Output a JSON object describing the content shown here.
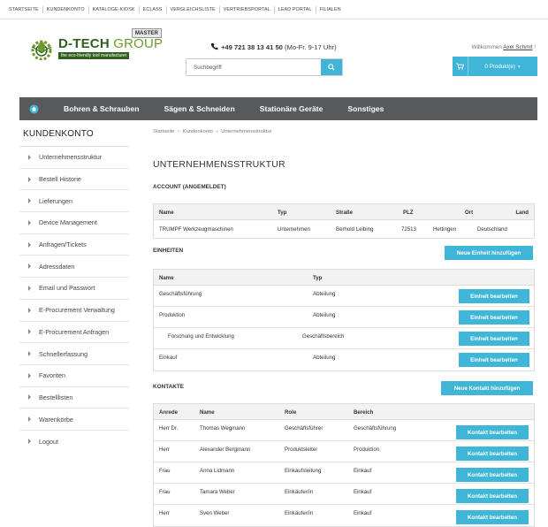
{
  "topnav": [
    "STARTSEITE",
    "KUNDENKONTO",
    "KATALOGE-KIOSK",
    "ECLASS",
    "VERGLEICHSLISTE",
    "VERTRIEBSPORTAL",
    "LEAD PORTAL",
    "FILIALEN"
  ],
  "header": {
    "master_badge": "MASTER",
    "brand_main": "D-TECH",
    "brand_group": "GROUP",
    "tagline": "the eco-friendly tool manufacturer",
    "phone_number": "+49 721 38 13 41 50",
    "phone_hours": "(Mo-Fr. 9-17 Uhr)",
    "search_placeholder": "Suchbegriff",
    "welcome_text": "Willkommen",
    "user_name": "Axel Schmit",
    "welcome_suffix": "!",
    "cart_label": "0 Produkt(e)"
  },
  "mainnav": [
    "Bohren & Schrauben",
    "Sägen & Schneiden",
    "Stationäre Geräte",
    "Sonstiges"
  ],
  "sidebar": {
    "title": "KUNDENKONTO",
    "items": [
      "Unternehmensstruktur",
      "Bestell Historie",
      "Lieferungen",
      "Device Management",
      "Anfragen/Tickets",
      "Adressdaten",
      "Email und Passwort",
      "E-Procurement Verwaltung",
      "E-Procurement Anfragen",
      "Schnellerfassung",
      "Favoriten",
      "Bestelllisten",
      "Warenkörbe",
      "Logout"
    ]
  },
  "breadcrumb": [
    "Startseite",
    "Kundenkonto",
    "Unternehmensstruktur"
  ],
  "page_title": "UNTERNEHMENSSTRUKTUR",
  "account": {
    "heading": "ACCOUNT (ANGEMELDET)",
    "headers": [
      "Name",
      "Typ",
      "Straße",
      "PLZ",
      "Ort",
      "Land"
    ],
    "row": [
      "TRUMPF Werkzeugmaschinen",
      "Unternehmen",
      "Berhold Leibing",
      "72513",
      "Hettingen",
      "Deutschland"
    ]
  },
  "units": {
    "heading": "EINHEITEN",
    "add_button": "Neue Einheit hinzufügen",
    "edit_button": "Einheit bearbeiten",
    "headers": [
      "Name",
      "Typ"
    ],
    "rows": [
      {
        "name": "Geschäftsführung",
        "type": "Abteilung"
      },
      {
        "name": "Produktion",
        "type": "Abteilung"
      },
      {
        "name": "Forschung und Entwicklung",
        "type": "Geschäftsbereich"
      },
      {
        "name": "Einkauf",
        "type": "Abteilung"
      }
    ]
  },
  "contacts": {
    "heading": "KONTAKTE",
    "add_button": "Neue Kontakt hinzufügen",
    "edit_button": "Kontakt bearbeiten",
    "headers": [
      "Anrede",
      "Name",
      "Role",
      "Bereich"
    ],
    "rows": [
      {
        "salutation": "Herr Dr.",
        "name": "Thomas Wegmann",
        "role": "Geschäftsführer",
        "area": "Geschäftsführung"
      },
      {
        "salutation": "Herr",
        "name": "Alexander Bergmann",
        "role": "Produktsleiter",
        "area": "Produktion"
      },
      {
        "salutation": "Frau",
        "name": "Anna Lidmann",
        "role": "Einkaufsleitung",
        "area": "Einkauf"
      },
      {
        "salutation": "Frau",
        "name": "Tamara Weber",
        "role": "Einkäufer/in",
        "area": "Einkauf"
      },
      {
        "salutation": "Herr",
        "name": "Sven Weber",
        "role": "Einkäufer/in",
        "area": "Einkauf"
      }
    ]
  },
  "colors": {
    "accent": "#3fb6d8",
    "nav_bg": "#58595b",
    "brand_green": "#2f5f1e",
    "brand_light_green": "#6a9c2c"
  }
}
